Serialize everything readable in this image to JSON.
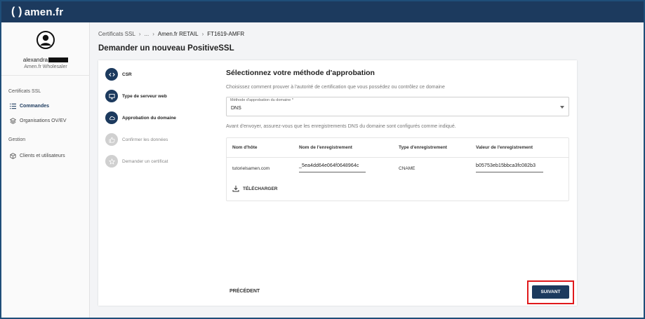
{
  "brand": {
    "logo_paren": "( )",
    "logo_text": "amen.fr"
  },
  "user": {
    "name": "alexandra",
    "org": "Amen.fr Wholesaler"
  },
  "sidebar": {
    "section_certs": "Certificats SSL",
    "items": [
      {
        "label": "Commandes",
        "icon": "list-icon",
        "active": true
      },
      {
        "label": "Organisations OV/EV",
        "icon": "layers-icon",
        "active": false
      }
    ],
    "section_gestion": "Gestion",
    "gestion_items": [
      {
        "label": "Clients et utilisateurs",
        "icon": "cube-icon"
      }
    ]
  },
  "breadcrumb": [
    "Certificats SSL",
    "...",
    "Amen.fr RETAIL",
    "FT1619-AMFR"
  ],
  "page_title": "Demander un nouveau PositiveSSL",
  "steps": [
    {
      "label": "CSR",
      "state": "done",
      "icon": "code-icon"
    },
    {
      "label": "Type de serveur web",
      "state": "done",
      "icon": "monitor-icon"
    },
    {
      "label": "Approbation du domaine",
      "state": "done",
      "icon": "cloud-icon"
    },
    {
      "label": "Confirmer les données",
      "state": "todo",
      "icon": "thumb-up-icon"
    },
    {
      "label": "Demander un certificat",
      "state": "todo",
      "icon": "star-icon"
    }
  ],
  "approval": {
    "title": "Sélectionnez votre méthode d'approbation",
    "subtitle": "Choisissez comment prouver à l'autorité de certification que vous possédez ou contrôlez ce domaine",
    "select_label": "Méthode d'approbation du domaine *",
    "select_value": "DNS",
    "note": "Avant d'envoyer, assurez-vous que les enregistrements DNS du domaine sont configurés comme indiqué."
  },
  "table": {
    "headers": [
      "Nom d'hôte",
      "Nom de l'enregistrement",
      "Type d'enregistrement",
      "Valeur de l'enregistrement"
    ],
    "row": {
      "host": "tutorielsamen.com",
      "record_name": "_5ea4dd64e064f0648964c",
      "record_type": "CNAME",
      "record_value": "b05753eb15bbca3fc082b3"
    },
    "download_label": "TÉLÉCHARGER"
  },
  "footer": {
    "prev_label": "PRÉCÉDENT",
    "next_label": "SUIVANT"
  },
  "colors": {
    "brand": "#1c3a5e",
    "highlight": "#e0191c"
  }
}
